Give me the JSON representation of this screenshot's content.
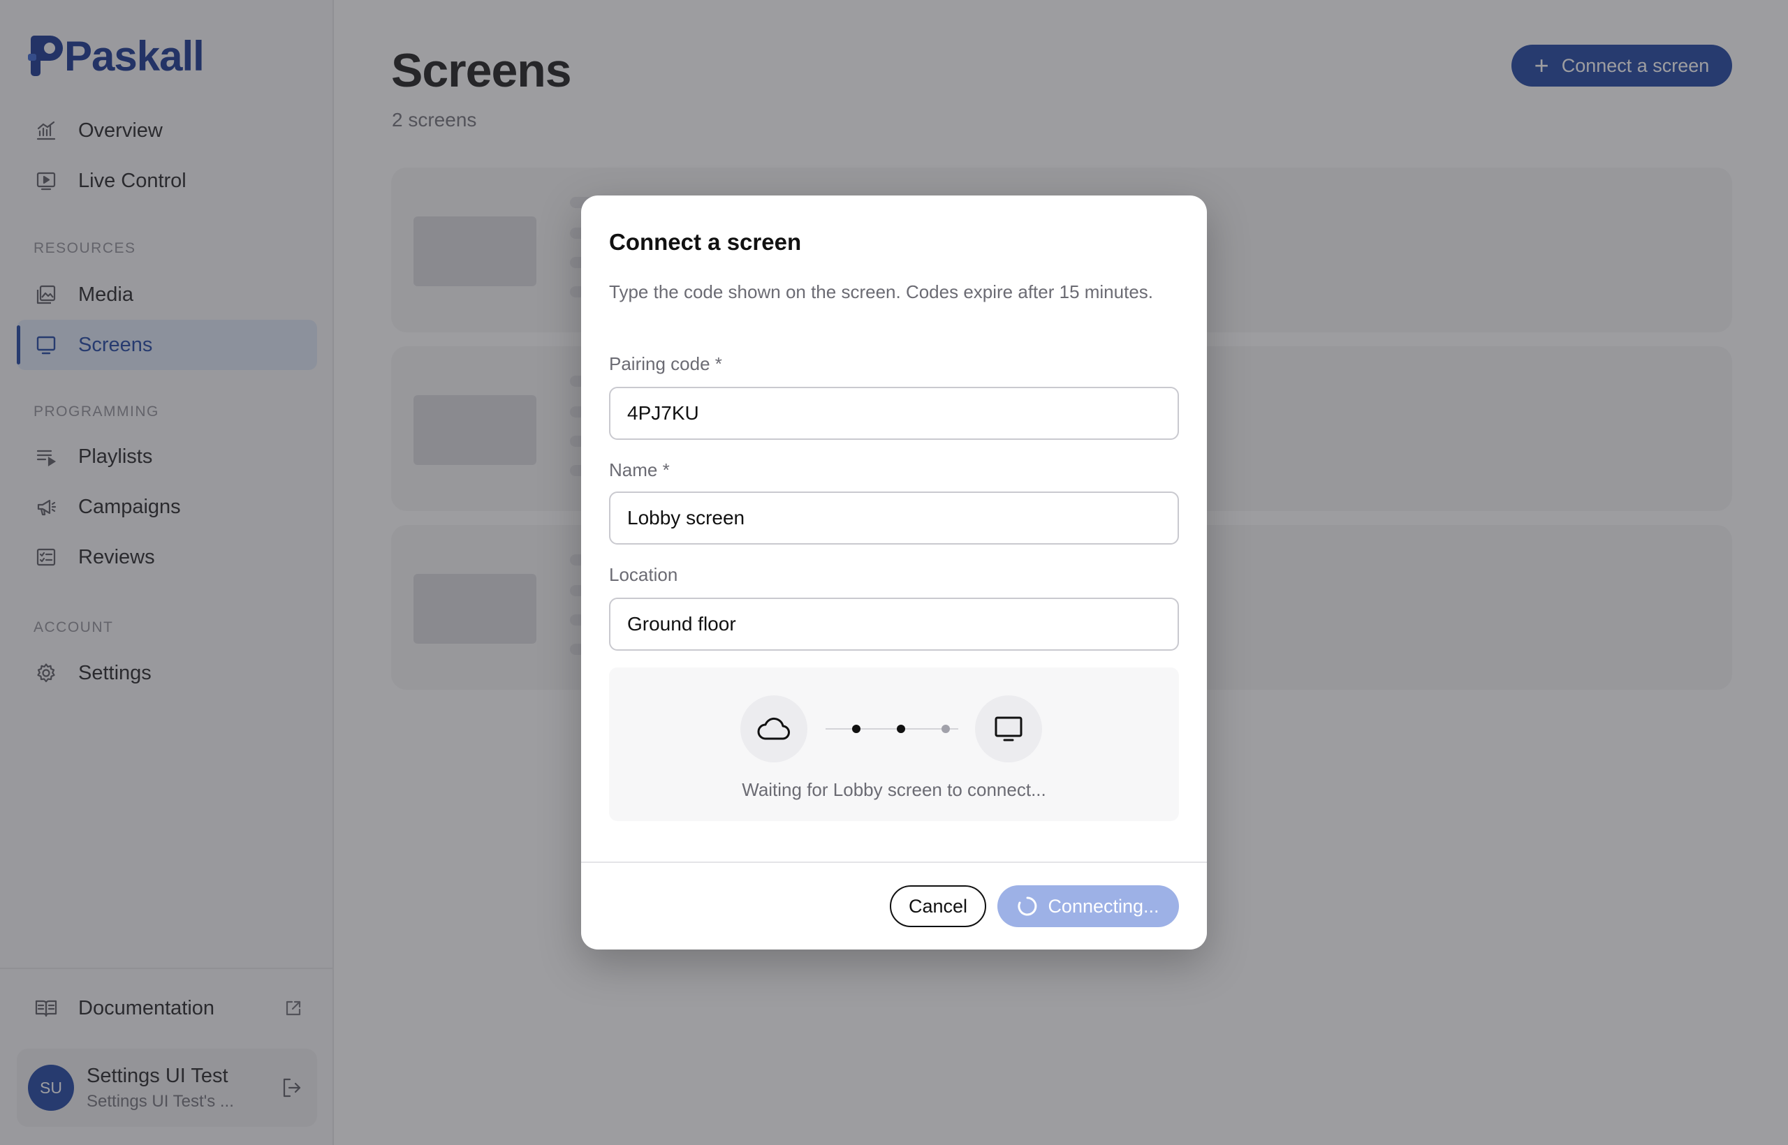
{
  "app": {
    "brand": "Paskall",
    "accent_color": "#123a9c"
  },
  "sidebar": {
    "nav_top": [
      {
        "label": "Overview",
        "icon": "chart-icon"
      },
      {
        "label": "Live Control",
        "icon": "play-screen-icon"
      }
    ],
    "sections": [
      {
        "title": "RESOURCES",
        "items": [
          {
            "label": "Media",
            "icon": "gallery-icon"
          },
          {
            "label": "Screens",
            "icon": "monitor-icon",
            "active": true
          }
        ]
      },
      {
        "title": "PROGRAMMING",
        "items": [
          {
            "label": "Playlists",
            "icon": "playlist-icon"
          },
          {
            "label": "Campaigns",
            "icon": "megaphone-icon"
          },
          {
            "label": "Reviews",
            "icon": "checklist-icon"
          }
        ]
      },
      {
        "title": "ACCOUNT",
        "items": [
          {
            "label": "Settings",
            "icon": "gear-icon"
          }
        ]
      }
    ],
    "documentation": "Documentation",
    "user": {
      "initials": "SU",
      "name": "Settings UI Test",
      "org": "Settings UI Test's ..."
    }
  },
  "main": {
    "title": "Screens",
    "subtitle": "2 screens",
    "connect_button": "Connect a screen"
  },
  "dialog": {
    "title": "Connect a screen",
    "description": "Type the code shown on the screen. Codes expire after 15 minutes.",
    "fields": {
      "pairing_code": {
        "label": "Pairing code *",
        "value": "4PJ7KU"
      },
      "name": {
        "label": "Name *",
        "value": "Lobby screen"
      },
      "location": {
        "label": "Location",
        "value": "Ground floor"
      }
    },
    "status": "Waiting for Lobby screen to connect...",
    "cancel": "Cancel",
    "submit": "Connecting..."
  }
}
